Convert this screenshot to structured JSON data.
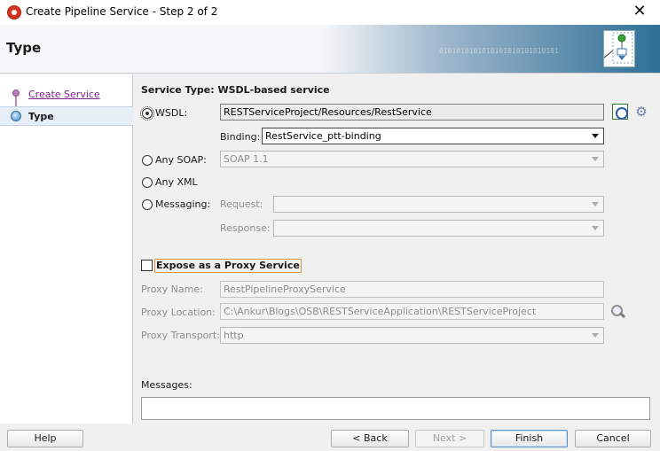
{
  "window": {
    "title": "Create Pipeline Service - Step 2 of 2",
    "close_glyph": "✕"
  },
  "header": {
    "title": "Type",
    "binary_decoration": "0101010101010101010101010101"
  },
  "nav": {
    "items": [
      {
        "label": "Create Service",
        "state": "completed-link"
      },
      {
        "label": "Type",
        "state": "current"
      }
    ]
  },
  "content": {
    "section_title": "Service Type: WSDL-based service",
    "wsdl": {
      "label": "WSDL:",
      "selected": true,
      "value": "RESTServiceProject/Resources/RestService",
      "binding_label": "Binding:",
      "binding_value": "RestService_ptt-binding"
    },
    "any_soap": {
      "label": "Any SOAP:",
      "selected": false,
      "value": "SOAP 1.1"
    },
    "any_xml": {
      "label": "Any XML",
      "selected": false
    },
    "messaging": {
      "label": "Messaging:",
      "selected": false,
      "request_label": "Request:",
      "request_value": "",
      "response_label": "Response:",
      "response_value": ""
    },
    "proxy": {
      "checkbox_label": "Expose as a Proxy Service",
      "checked": false,
      "name_label": "Proxy Name:",
      "name_value": "RestPipelineProxyService",
      "location_label": "Proxy Location:",
      "location_value": "C:\\Ankur\\Blogs\\OSB\\RESTServiceApplication\\RESTServiceProject",
      "transport_label": "Proxy Transport:",
      "transport_value": "http"
    },
    "messages_label": "Messages:",
    "messages_value": ""
  },
  "icons": {
    "gear": "⚙"
  },
  "footer": {
    "help": "Help",
    "back": "< Back",
    "next": "Next >",
    "finish": "Finish",
    "cancel": "Cancel"
  }
}
